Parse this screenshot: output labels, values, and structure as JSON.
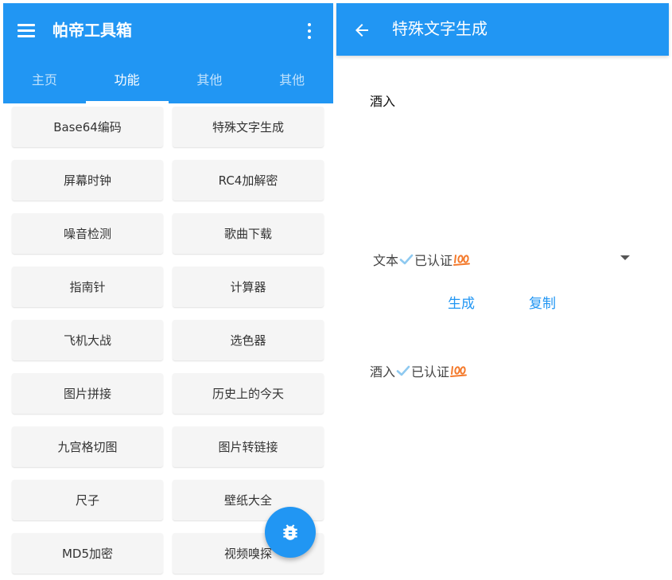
{
  "left": {
    "app_title": "帕帝工具箱",
    "tabs": [
      {
        "label": "主页",
        "active": false
      },
      {
        "label": "功能",
        "active": true
      },
      {
        "label": "其他",
        "active": false
      },
      {
        "label": "其他",
        "active": false
      }
    ],
    "tools": [
      "Base64编码",
      "特殊文字生成",
      "屏幕时钟",
      "RC4加解密",
      "噪音检测",
      "歌曲下载",
      "指南针",
      "计算器",
      "飞机大战",
      "选色器",
      "图片拼接",
      "历史上的今天",
      "九宫格切图",
      "图片转链接",
      "尺子",
      "壁纸大全",
      "MD5加密",
      "视频嗅探"
    ],
    "fab_icon": "bug-icon"
  },
  "right": {
    "page_title": "特殊文字生成",
    "input_value": "酒入",
    "style_select": {
      "selected_prefix": "文本",
      "selected_suffix": "已认证"
    },
    "generate_label": "生成",
    "copy_label": "复制",
    "output": {
      "prefix": "酒入",
      "suffix": "已认证"
    }
  },
  "colors": {
    "primary": "#2196f3",
    "button_bg": "#f5f5f5",
    "check": "#8ec9f0",
    "hundred": "#f47a2c"
  }
}
